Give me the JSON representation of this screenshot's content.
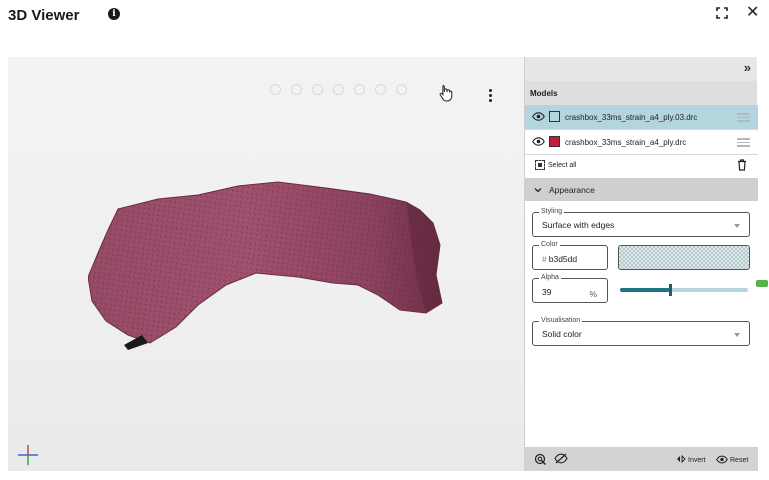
{
  "header": {
    "title": "3D Viewer",
    "info_icon": "info-icon",
    "fullscreen_icon": "fullscreen-icon",
    "close_icon": "close-icon",
    "close_glyph": "✕"
  },
  "viewport": {
    "menu_icon": "kebab-icon",
    "axes_icon": "axes-gizmo-icon",
    "model_color": "#8a3f5a"
  },
  "panel": {
    "collapse_glyph": "»",
    "models_title": "Models",
    "models": [
      {
        "name": "crashbox_33ms_strain_a4_ply.03.drc",
        "color": "#b3d5dd",
        "selected": true
      },
      {
        "name": "crashbox_33ms_strain_a4_ply.drc",
        "color": "#c0213a",
        "selected": false
      }
    ],
    "select_all_label": "Select all",
    "appearance": {
      "title": "Appearance",
      "styling_label": "Styling",
      "styling_value": "Surface with edges",
      "color_label": "Color",
      "color_hash": "#",
      "color_value": "b3d5dd",
      "alpha_label": "Alpha",
      "alpha_value": "39",
      "alpha_unit": "%",
      "alpha_fraction": 0.39,
      "visualisation_label": "Visualisation",
      "visualisation_value": "Solid color"
    },
    "footer": {
      "invert_label": "Invert",
      "reset_label": "Reset"
    }
  },
  "colors": {
    "accent": "#1f7383",
    "selection": "#b3d5dd"
  }
}
